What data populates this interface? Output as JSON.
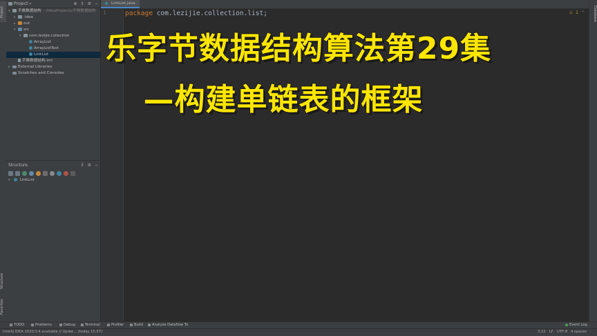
{
  "left_stripe": {
    "project_tab": "Project",
    "structure_tab": "Structure",
    "favorites_tab": "Favorites"
  },
  "right_stripe": {
    "database_tab": "Database"
  },
  "project_panel": {
    "title": "Project",
    "tree": [
      {
        "label": "手撕数据结构",
        "hint": "~/IdeaProjects/手撕数据结构",
        "icon": "folder-icon",
        "indent": 0,
        "arrow": "▾"
      },
      {
        "label": ".idea",
        "hint": "",
        "icon": "folder-icon",
        "indent": 1,
        "arrow": "▸"
      },
      {
        "label": "out",
        "hint": "",
        "icon": "folder-orange-icon",
        "indent": 1,
        "arrow": "▸"
      },
      {
        "label": "src",
        "hint": "",
        "icon": "folder-blue-icon",
        "indent": 1,
        "arrow": "▾"
      },
      {
        "label": "com.lezijie.collection",
        "hint": "",
        "icon": "package-icon",
        "indent": 2,
        "arrow": "▾"
      },
      {
        "label": "ArrayList",
        "hint": "",
        "icon": "class-icon",
        "indent": 3,
        "arrow": ""
      },
      {
        "label": "ArrayListTest",
        "hint": "",
        "icon": "class-icon",
        "indent": 3,
        "arrow": ""
      },
      {
        "label": "LinkList",
        "hint": "",
        "icon": "class-icon",
        "indent": 3,
        "arrow": "",
        "selected": true
      },
      {
        "label": "手撕数据结构.iml",
        "hint": "",
        "icon": "iml-file-icon",
        "indent": 1,
        "arrow": ""
      },
      {
        "label": "External Libraries",
        "hint": "",
        "icon": "library-icon",
        "indent": 0,
        "arrow": "▸"
      },
      {
        "label": "Scratches and Consoles",
        "hint": "",
        "icon": "scratch-icon",
        "indent": 0,
        "arrow": ""
      }
    ]
  },
  "structure_panel": {
    "title": "Structure",
    "tree": [
      {
        "label": "LinkList"
      }
    ]
  },
  "editor": {
    "tab_label": "LinkList.java",
    "line_number": "1",
    "code_keyword": "package",
    "code_rest": " com.lezijie.collection.list;",
    "warning_count": "1"
  },
  "overlay": {
    "line1": "乐字节数据结构算法第29集",
    "line2": "—构建单链表的框架"
  },
  "bottom_bar": {
    "items": [
      "TODO",
      "Problems",
      "Debug",
      "Terminal",
      "Profiler",
      "Build",
      "Analyze Dataflow To"
    ],
    "event_log": "Event Log"
  },
  "status_bar": {
    "message": "IntelliJ IDEA 2020.3.4 available // Updat... (today 15:57)",
    "position": "3:22",
    "line_sep": "LF",
    "encoding": "UTF-8",
    "indent": "4 spaces"
  }
}
